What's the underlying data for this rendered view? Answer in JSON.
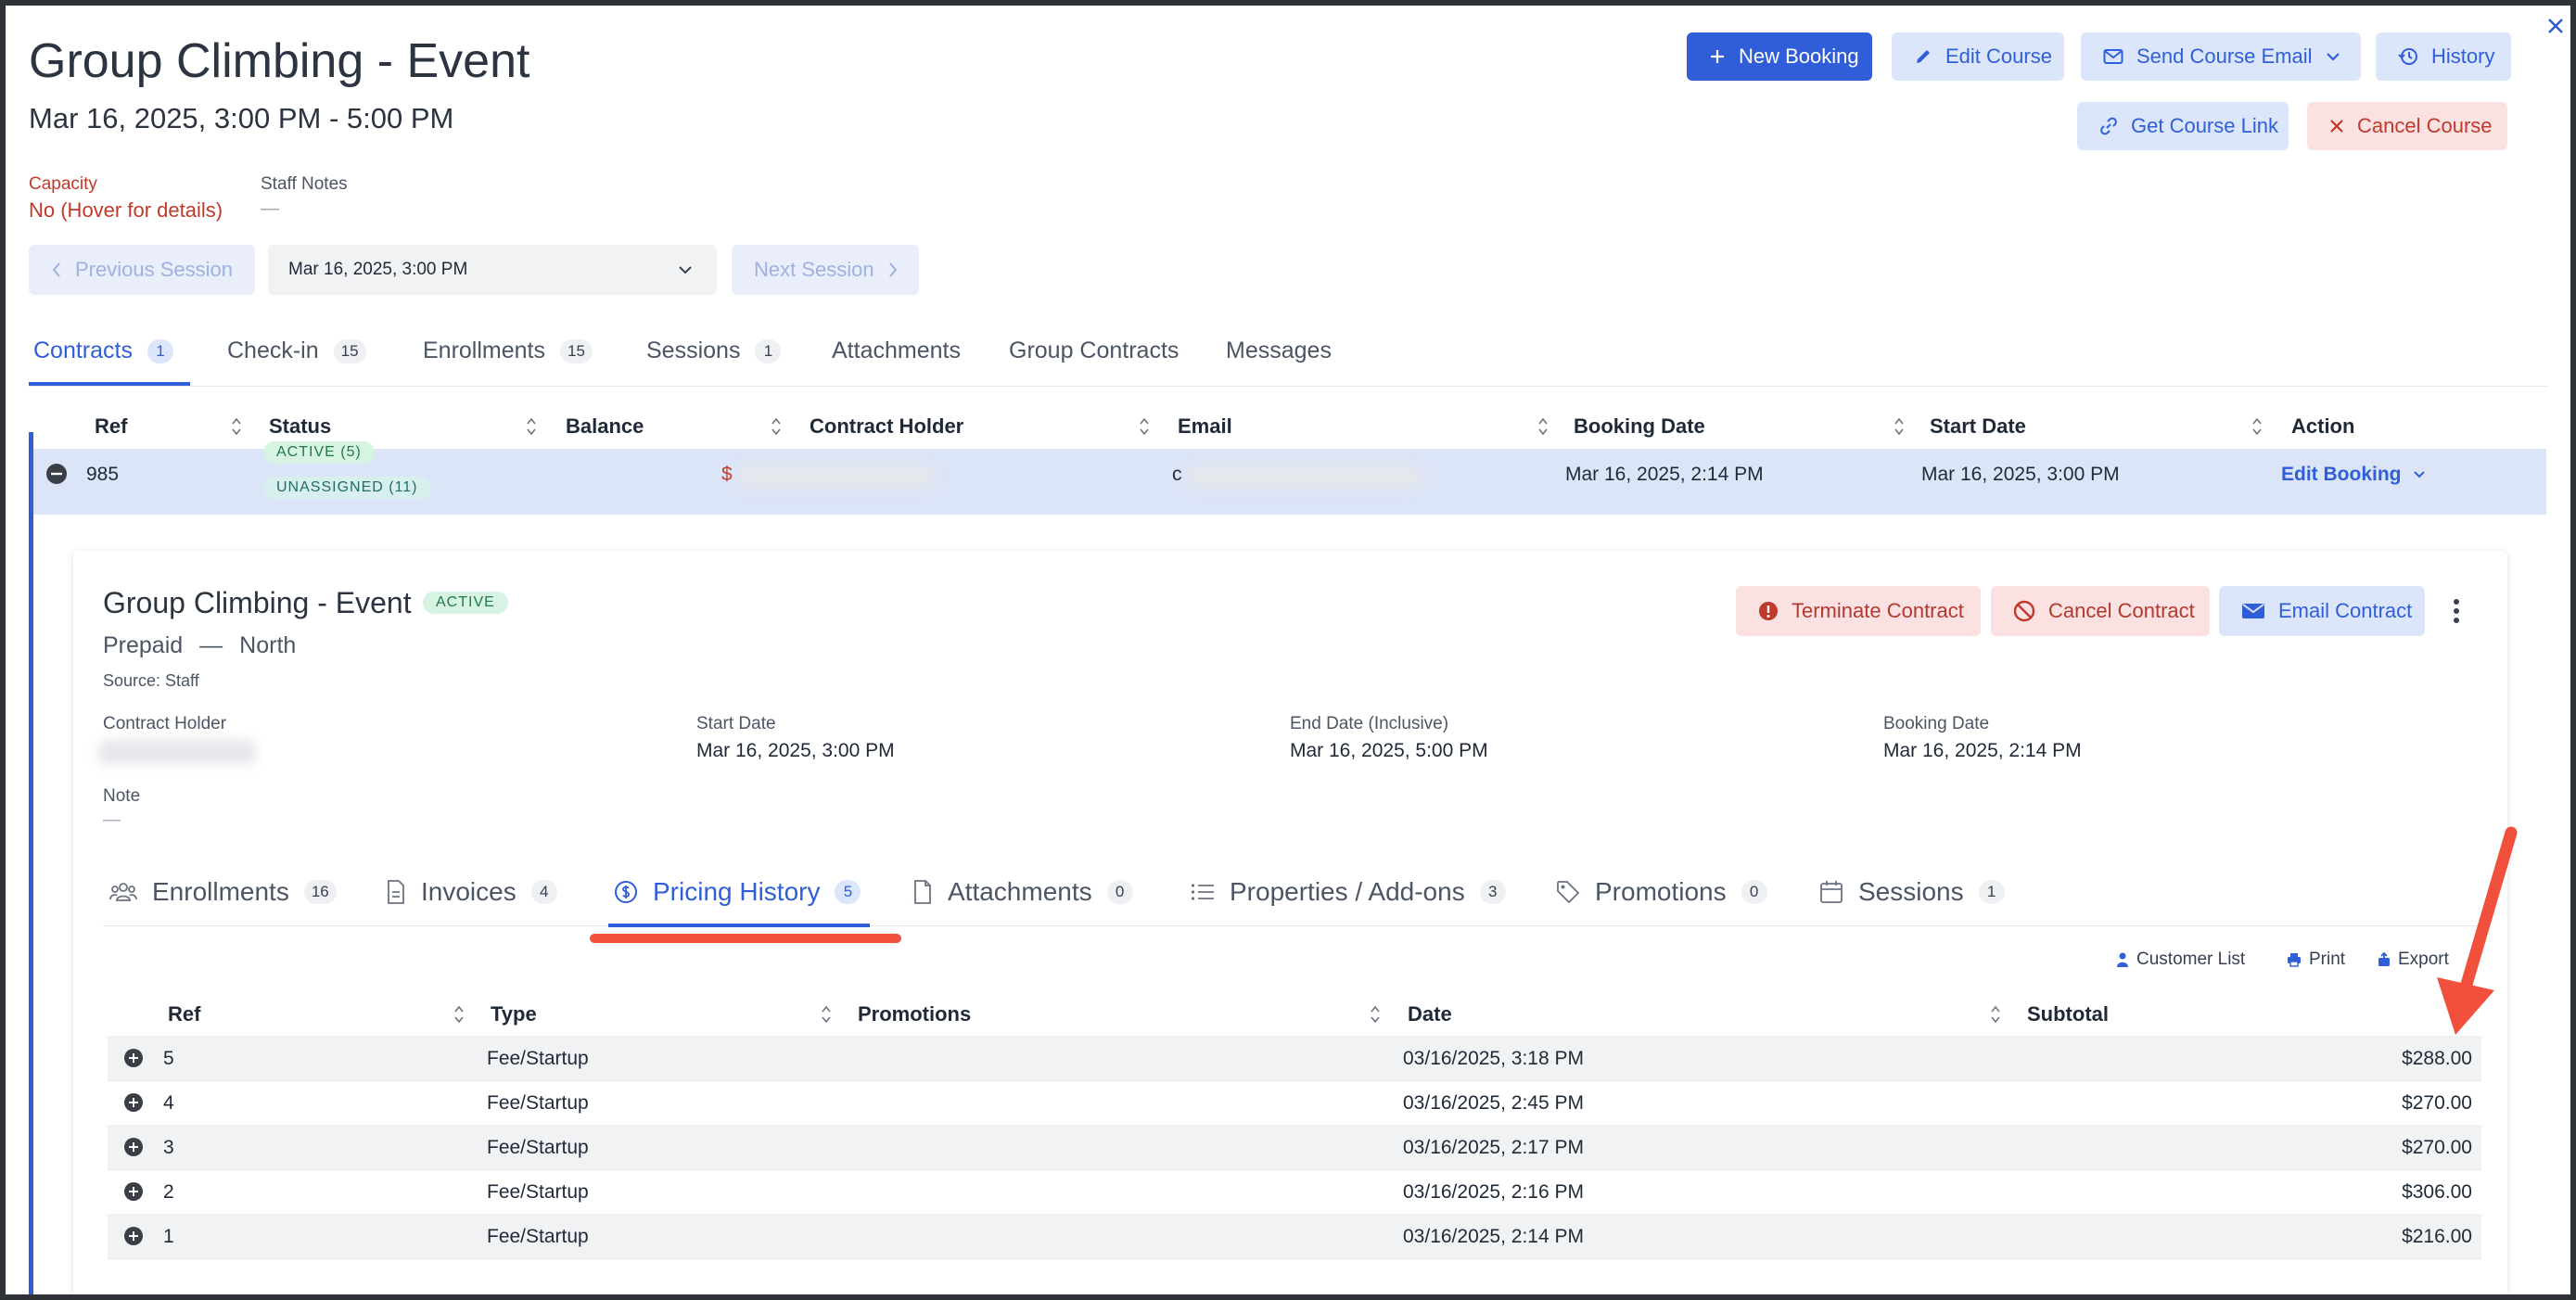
{
  "header": {
    "title": "Group Climbing - Event",
    "subtitle": "Mar 16, 2025, 3:00 PM - 5:00 PM"
  },
  "toolbar": {
    "new_booking": "New Booking",
    "edit_course": "Edit Course",
    "send_course_email": "Send Course Email",
    "history": "History",
    "get_course_link": "Get Course Link",
    "cancel_course": "Cancel Course"
  },
  "meta": {
    "capacity_label": "Capacity",
    "capacity_value": "No (Hover for details)",
    "staff_notes_label": "Staff Notes",
    "staff_notes_value": "—"
  },
  "session_nav": {
    "previous": "Previous Session",
    "selected": "Mar 16, 2025, 3:00 PM",
    "next": "Next Session"
  },
  "main_tabs": [
    {
      "label": "Contracts",
      "count": "1"
    },
    {
      "label": "Check-in",
      "count": "15"
    },
    {
      "label": "Enrollments",
      "count": "15"
    },
    {
      "label": "Sessions",
      "count": "1"
    },
    {
      "label": "Attachments",
      "count": ""
    },
    {
      "label": "Group Contracts",
      "count": ""
    },
    {
      "label": "Messages",
      "count": ""
    }
  ],
  "contracts_table": {
    "columns": [
      "Ref",
      "Status",
      "Balance",
      "Contract Holder",
      "Email",
      "Booking Date",
      "Start Date",
      "Action"
    ],
    "row": {
      "ref": "985",
      "status_active": "ACTIVE (5)",
      "status_unassigned": "UNASSIGNED (11)",
      "balance_prefix": "$",
      "email_prefix": "c",
      "booking_date": "Mar 16, 2025, 2:14 PM",
      "start_date": "Mar 16, 2025, 3:00 PM",
      "action": "Edit Booking"
    }
  },
  "contract_detail": {
    "title": "Group Climbing - Event",
    "status": "ACTIVE",
    "plan": "Prepaid",
    "separator": "—",
    "location": "North",
    "source": "Source: Staff",
    "buttons": {
      "terminate": "Terminate Contract",
      "cancel": "Cancel Contract",
      "email": "Email Contract"
    },
    "fields": {
      "holder_label": "Contract Holder",
      "start_label": "Start Date",
      "start_value": "Mar 16, 2025, 3:00 PM",
      "end_label": "End Date (Inclusive)",
      "end_value": "Mar 16, 2025, 5:00 PM",
      "booking_label": "Booking Date",
      "booking_value": "Mar 16, 2025, 2:14 PM",
      "note_label": "Note",
      "note_value": "—"
    },
    "tabs": [
      {
        "label": "Enrollments",
        "count": "16"
      },
      {
        "label": "Invoices",
        "count": "4"
      },
      {
        "label": "Pricing History",
        "count": "5"
      },
      {
        "label": "Attachments",
        "count": "0"
      },
      {
        "label": "Properties / Add-ons",
        "count": "3"
      },
      {
        "label": "Promotions",
        "count": "0"
      },
      {
        "label": "Sessions",
        "count": "1"
      }
    ],
    "actions": {
      "customer_list": "Customer List",
      "print": "Print",
      "export": "Export"
    }
  },
  "pricing_table": {
    "columns": [
      "Ref",
      "Type",
      "Promotions",
      "Date",
      "Subtotal"
    ],
    "rows": [
      {
        "ref": "5",
        "type": "Fee/Startup",
        "promotions": "",
        "date": "03/16/2025, 3:18 PM",
        "subtotal": "$288.00"
      },
      {
        "ref": "4",
        "type": "Fee/Startup",
        "promotions": "",
        "date": "03/16/2025, 2:45 PM",
        "subtotal": "$270.00"
      },
      {
        "ref": "3",
        "type": "Fee/Startup",
        "promotions": "",
        "date": "03/16/2025, 2:17 PM",
        "subtotal": "$270.00"
      },
      {
        "ref": "2",
        "type": "Fee/Startup",
        "promotions": "",
        "date": "03/16/2025, 2:16 PM",
        "subtotal": "$306.00"
      },
      {
        "ref": "1",
        "type": "Fee/Startup",
        "promotions": "",
        "date": "03/16/2025, 2:14 PM",
        "subtotal": "$216.00"
      }
    ]
  },
  "colors": {
    "primary": "#2f5ed8",
    "danger": "#c0392b",
    "annotation": "#f0503c"
  }
}
